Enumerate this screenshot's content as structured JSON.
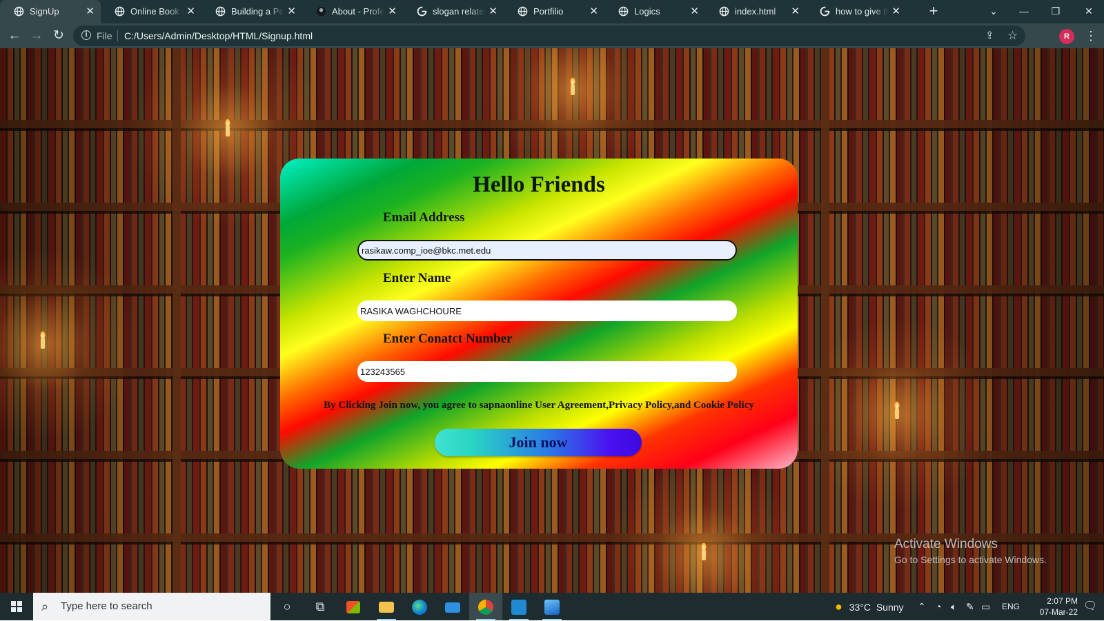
{
  "browser": {
    "tabs": [
      {
        "label": "SignUp",
        "icon": "globe-icon",
        "active": true
      },
      {
        "label": "Online Book store",
        "icon": "globe-icon",
        "active": false
      },
      {
        "label": "Building a Personal",
        "icon": "globe-icon",
        "active": false
      },
      {
        "label": "About - Professional",
        "icon": "profile-favicon-icon",
        "active": false
      },
      {
        "label": "slogan related to",
        "icon": "google-icon",
        "active": false
      },
      {
        "label": "Portfilio",
        "icon": "globe-icon",
        "active": false
      },
      {
        "label": "Logics",
        "icon": "globe-icon",
        "active": false
      },
      {
        "label": "index.html",
        "icon": "globe-icon",
        "active": false
      },
      {
        "label": "how to give the",
        "icon": "google-icon",
        "active": false
      }
    ],
    "address": {
      "scheme": "File",
      "url": "C:/Users/Admin/Desktop/HTML/Signup.html"
    },
    "profile_initial": "R"
  },
  "page": {
    "title": "Hello Friends",
    "fields": {
      "email_label": "Email Address",
      "email_value": "rasikaw.comp_ioe@bkc.met.edu",
      "name_label": "Enter Name",
      "name_value": "RASIKA WAGHCHOURE",
      "contact_label": "Enter Conatct Number",
      "contact_value": "123243565"
    },
    "agreement": "By Clicking Join now, you agree to sapnaonline User Agreement,Privacy Policy,and Cookie Policy",
    "join_label": "Join now"
  },
  "watermark": {
    "line1": "Activate Windows",
    "line2": "Go to Settings to activate Windows."
  },
  "taskbar": {
    "search_placeholder": "Type here to search",
    "weather": "33°C  Sunny",
    "language": "ENG",
    "time": "2:07 PM",
    "date": "07-Mar-22"
  },
  "colors": {
    "tab_bar": "#1f3438",
    "toolbar": "#35484c",
    "profile": "#d62d5b",
    "taskbar": "#1e2b2f"
  }
}
